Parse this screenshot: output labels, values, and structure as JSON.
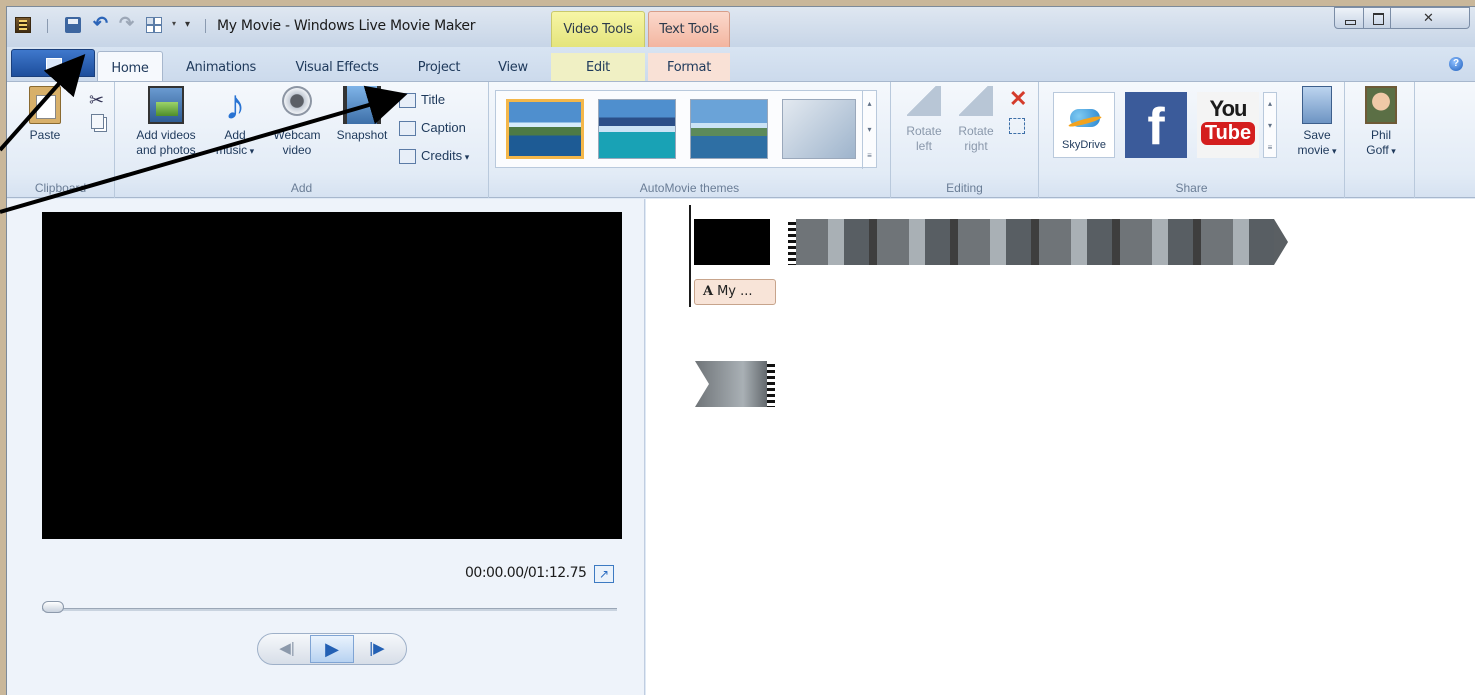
{
  "window": {
    "title": "My Movie - Windows Live Movie Maker",
    "context_tabs": {
      "video_tools": "Video Tools",
      "text_tools": "Text Tools"
    }
  },
  "tabs": [
    {
      "label": "Home",
      "selected": true
    },
    {
      "label": "Animations"
    },
    {
      "label": "Visual Effects"
    },
    {
      "label": "Project"
    },
    {
      "label": "View"
    },
    {
      "label": "Edit"
    },
    {
      "label": "Format"
    }
  ],
  "ribbon": {
    "clipboard": {
      "paste": "Paste",
      "group": "Clipboard"
    },
    "add": {
      "add_videos_line1": "Add videos",
      "add_videos_line2": "and photos",
      "add_music_line1": "Add",
      "add_music_line2": "music",
      "webcam_line1": "Webcam",
      "webcam_line2": "video",
      "snapshot": "Snapshot",
      "title": "Title",
      "caption": "Caption",
      "credits": "Credits",
      "group": "Add"
    },
    "themes": {
      "group": "AutoMovie themes"
    },
    "editing": {
      "rotate_left_line1": "Rotate",
      "rotate_left_line2": "left",
      "rotate_right_line1": "Rotate",
      "rotate_right_line2": "right",
      "group": "Editing"
    },
    "share": {
      "skydrive": "SkyDrive",
      "facebook": "f",
      "youtube_you": "You",
      "youtube_tube": "Tube",
      "save_movie_line1": "Save",
      "save_movie_line2": "movie",
      "group": "Share"
    },
    "account": {
      "name_line1": "Phil",
      "name_line2": "Goff"
    }
  },
  "preview": {
    "timecode": "00:00.00/01:12.75",
    "seek_position": 0
  },
  "storyboard": {
    "caption_chip_letter": "A",
    "caption_chip_text": "My ..."
  }
}
